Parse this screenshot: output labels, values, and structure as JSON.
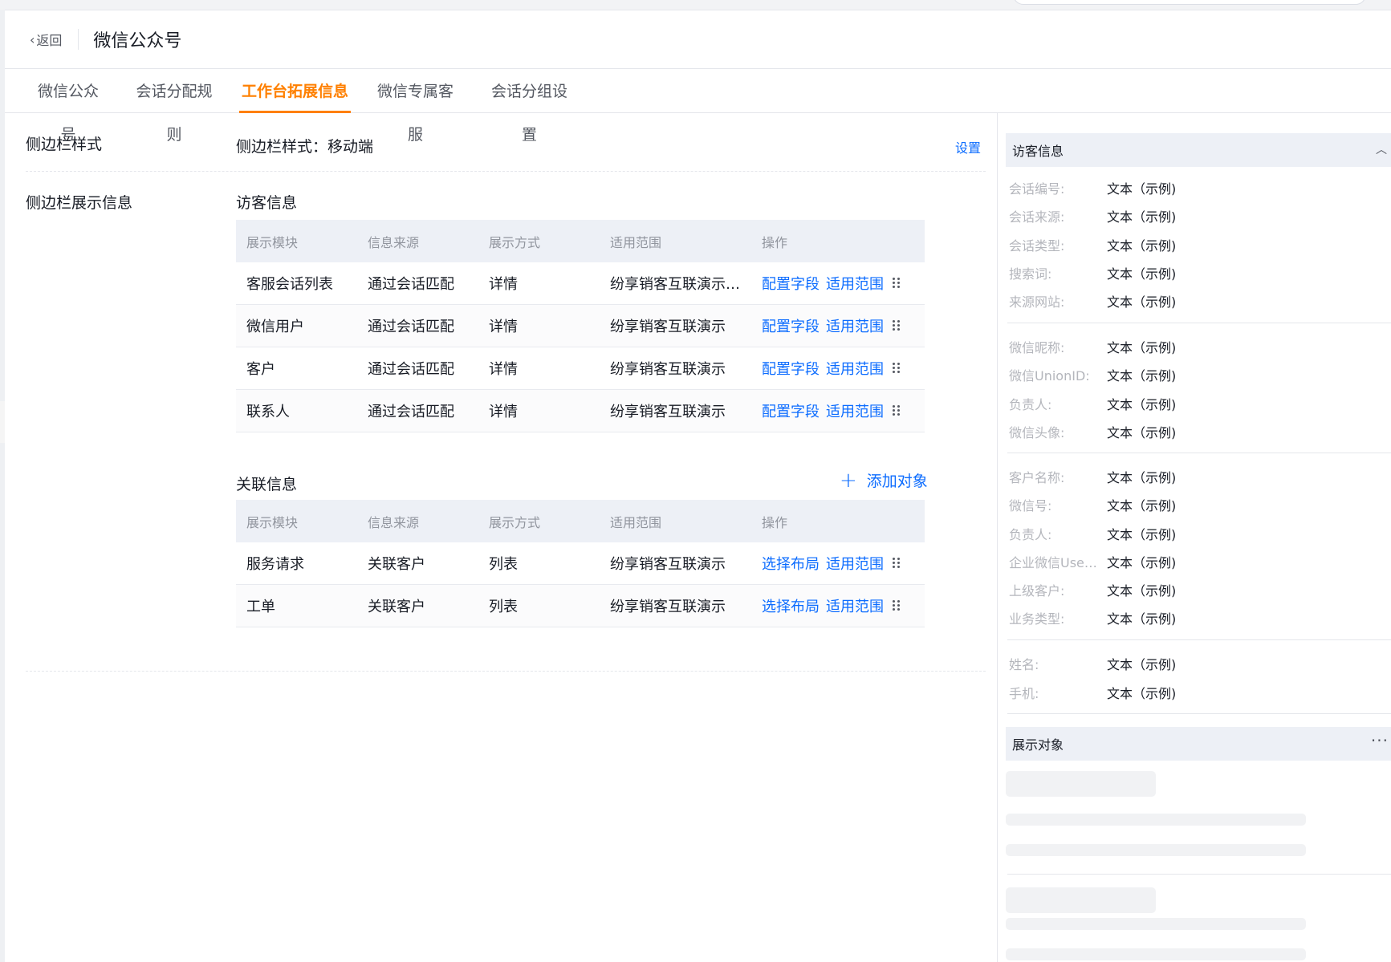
{
  "header": {
    "back_label": "返回",
    "title": "微信公众号"
  },
  "tabs": [
    {
      "label": "微信公众号",
      "active": false
    },
    {
      "label": "会话分配规则",
      "active": false
    },
    {
      "label": "工作台拓展信息",
      "active": true
    },
    {
      "label": "微信专属客服",
      "active": false
    },
    {
      "label": "会话分组设置",
      "active": false
    }
  ],
  "sidebar_style": {
    "label": "侧边栏样式",
    "value": "侧边栏样式：移动端",
    "action": "设置"
  },
  "sidebar_display": {
    "label": "侧边栏展示信息"
  },
  "visitor_section": {
    "title": "访客信息",
    "columns": [
      "展示模块",
      "信息来源",
      "展示方式",
      "适用范围",
      "操作"
    ],
    "rows": [
      {
        "module": "客服会话列表",
        "source": "通过会话匹配",
        "mode": "详情",
        "scope": "纷享销客互联演示空间",
        "action1": "配置字段",
        "action2": "适用范围"
      },
      {
        "module": "微信用户",
        "source": "通过会话匹配",
        "mode": "详情",
        "scope": "纷享销客互联演示",
        "action1": "配置字段",
        "action2": "适用范围"
      },
      {
        "module": "客户",
        "source": "通过会话匹配",
        "mode": "详情",
        "scope": "纷享销客互联演示",
        "action1": "配置字段",
        "action2": "适用范围"
      },
      {
        "module": "联系人",
        "source": "通过会话匹配",
        "mode": "详情",
        "scope": "纷享销客互联演示",
        "action1": "配置字段",
        "action2": "适用范围"
      }
    ]
  },
  "related_section": {
    "title": "关联信息",
    "add_label": "添加对象",
    "columns": [
      "展示模块",
      "信息来源",
      "展示方式",
      "适用范围",
      "操作"
    ],
    "rows": [
      {
        "module": "服务请求",
        "source": "关联客户",
        "mode": "列表",
        "scope": "纷享销客互联演示",
        "action1": "选择布局",
        "action2": "适用范围"
      },
      {
        "module": "工单",
        "source": "关联客户",
        "mode": "列表",
        "scope": "纷享销客互联演示",
        "action1": "选择布局",
        "action2": "适用范围"
      }
    ]
  },
  "preview": {
    "visitor_title": "访客信息",
    "groups": [
      [
        {
          "label": "会话编号:",
          "value": "文本（示例)"
        },
        {
          "label": "会话来源:",
          "value": "文本（示例)"
        },
        {
          "label": "会话类型:",
          "value": "文本（示例)"
        },
        {
          "label": "搜索词:",
          "value": "文本（示例)"
        },
        {
          "label": "来源网站:",
          "value": "文本（示例)"
        }
      ],
      [
        {
          "label": "微信昵称:",
          "value": "文本（示例)"
        },
        {
          "label": "微信UnionID:",
          "value": "文本（示例)"
        },
        {
          "label": "负责人:",
          "value": "文本（示例)"
        },
        {
          "label": "微信头像:",
          "value": "文本（示例)"
        }
      ],
      [
        {
          "label": "客户名称:",
          "value": "文本（示例)"
        },
        {
          "label": "微信号:",
          "value": "文本（示例)"
        },
        {
          "label": "负责人:",
          "value": "文本（示例)"
        },
        {
          "label": "企业微信UserID:",
          "value": "文本（示例)"
        },
        {
          "label": "上级客户:",
          "value": "文本（示例)"
        },
        {
          "label": "业务类型:",
          "value": "文本（示例)"
        }
      ],
      [
        {
          "label": "姓名:",
          "value": "文本（示例)"
        },
        {
          "label": "手机:",
          "value": "文本（示例)"
        }
      ]
    ],
    "objects_title": "展示对象",
    "more_icon": "more-icon",
    "collapse_icon": "chevron-up-icon"
  },
  "colors": {
    "accent": "#ff8000",
    "link": "#0c6cff",
    "header_bg": "#edf0f6"
  }
}
